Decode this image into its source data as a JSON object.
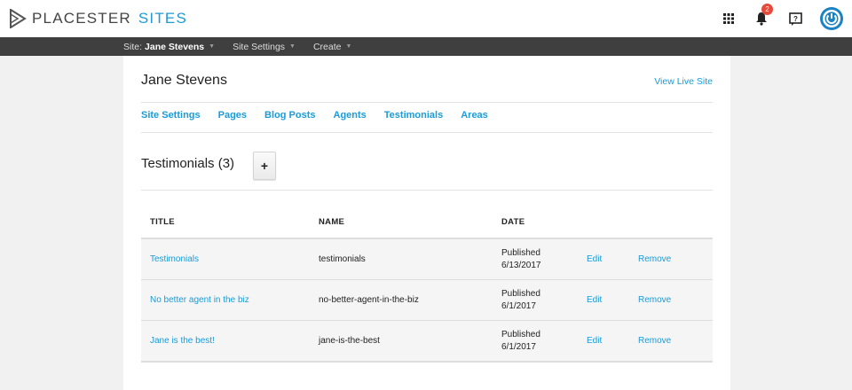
{
  "header": {
    "brand": "PLACESTER",
    "product": "SITES",
    "notification_count": "2",
    "accent_color": "#1b9bd7",
    "badge_color": "#e5493a"
  },
  "subnav": {
    "site_prefix": "Site:",
    "site_name": "Jane Stevens",
    "site_settings": "Site Settings",
    "create": "Create"
  },
  "page": {
    "title": "Jane Stevens",
    "view_live": "View Live Site",
    "tabs": [
      "Site Settings",
      "Pages",
      "Blog Posts",
      "Agents",
      "Testimonials",
      "Areas"
    ],
    "section_title": "Testimonials (3)",
    "add_label": "+"
  },
  "table": {
    "headers": [
      "TITLE",
      "NAME",
      "DATE"
    ],
    "rows": [
      {
        "title": "Testimonials",
        "name": "testimonials",
        "status": "Published",
        "date": "6/13/2017",
        "edit": "Edit",
        "remove": "Remove"
      },
      {
        "title": "No better agent in the biz",
        "name": "no-better-agent-in-the-biz",
        "status": "Published",
        "date": "6/1/2017",
        "edit": "Edit",
        "remove": "Remove"
      },
      {
        "title": "Jane is the best!",
        "name": "jane-is-the-best",
        "status": "Published",
        "date": "6/1/2017",
        "edit": "Edit",
        "remove": "Remove"
      }
    ]
  }
}
